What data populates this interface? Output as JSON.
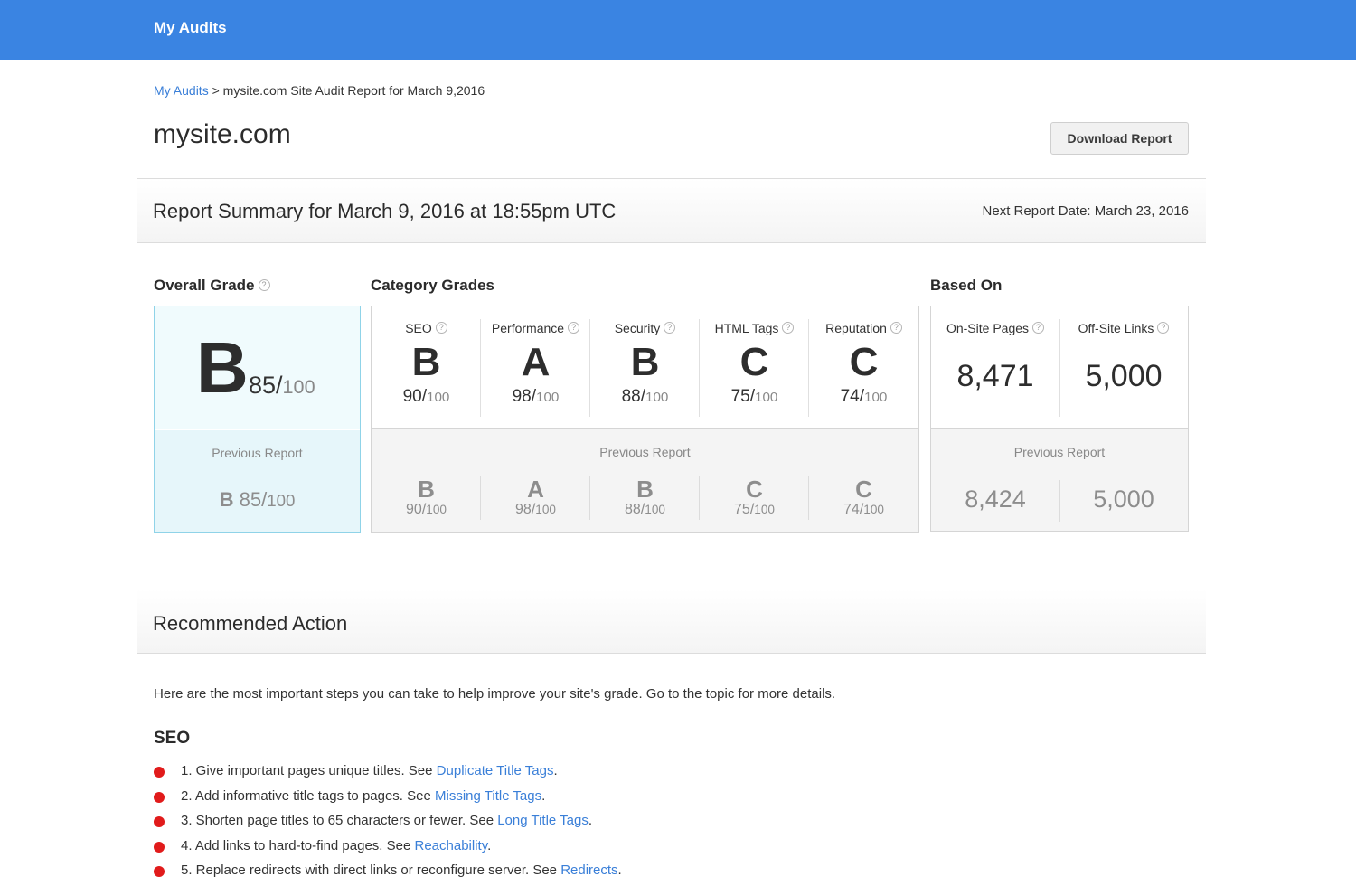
{
  "topbar": {
    "title": "My Audits"
  },
  "breadcrumb": {
    "root": "My Audits",
    "separator": ">",
    "current": "mysite.com Site Audit Report for March 9,2016"
  },
  "site": {
    "title": "mysite.com",
    "download_label": "Download Report"
  },
  "summary": {
    "heading": "Report Summary for March 9, 2016 at 18:55pm UTC",
    "next_date": "Next Report Date: March 23, 2016"
  },
  "overall": {
    "label": "Overall Grade",
    "help": "?",
    "grade": "B",
    "score": "85/",
    "denom": "100",
    "previous_label": "Previous Report",
    "previous_grade": "B",
    "previous_score": "85/",
    "previous_denom": "100"
  },
  "categories": {
    "label": "Category Grades",
    "help": "?",
    "previous_label": "Previous Report",
    "items": [
      {
        "name": "SEO",
        "grade": "B",
        "score": "90/",
        "denom": "100",
        "prev_grade": "B",
        "prev_score": "90/",
        "prev_denom": "100"
      },
      {
        "name": "Performance",
        "grade": "A",
        "score": "98/",
        "denom": "100",
        "prev_grade": "A",
        "prev_score": "98/",
        "prev_denom": "100"
      },
      {
        "name": "Security",
        "grade": "B",
        "score": "88/",
        "denom": "100",
        "prev_grade": "B",
        "prev_score": "88/",
        "prev_denom": "100"
      },
      {
        "name": "HTML Tags",
        "grade": "C",
        "score": "75/",
        "denom": "100",
        "prev_grade": "C",
        "prev_score": "75/",
        "prev_denom": "100"
      },
      {
        "name": "Reputation",
        "grade": "C",
        "score": "74/",
        "denom": "100",
        "prev_grade": "C",
        "prev_score": "74/",
        "prev_denom": "100"
      }
    ]
  },
  "based_on": {
    "label": "Based On",
    "help": "?",
    "previous_label": "Previous Report",
    "items": [
      {
        "name": "On-Site Pages",
        "value": "8,471",
        "previous": "8,424"
      },
      {
        "name": "Off-Site Links",
        "value": "5,000",
        "previous": "5,000"
      }
    ]
  },
  "recommended": {
    "heading": "Recommended Action",
    "intro": "Here are the most important steps you can take to help improve your site's grade. Go to the topic for more details.",
    "section": "SEO",
    "bullet_color": "#e11b1b",
    "items": [
      {
        "text": "1. Give important pages unique titles. See ",
        "link": "Duplicate Title Tags",
        "end": "."
      },
      {
        "text": "2. Add informative title tags to pages. See ",
        "link": "Missing Title Tags",
        "end": "."
      },
      {
        "text": "3. Shorten page titles to 65 characters or fewer. See ",
        "link": "Long Title Tags",
        "end": "."
      },
      {
        "text": "4. Add links to hard-to-find pages. See ",
        "link": "Reachability",
        "end": "."
      },
      {
        "text": "5. Replace redirects with direct links or reconfigure server. See ",
        "link": "Redirects",
        "end": "."
      }
    ]
  },
  "colors": {
    "brand": "#3a84e2",
    "link": "#3a7fd8",
    "overall_border": "#8fd3e8"
  }
}
